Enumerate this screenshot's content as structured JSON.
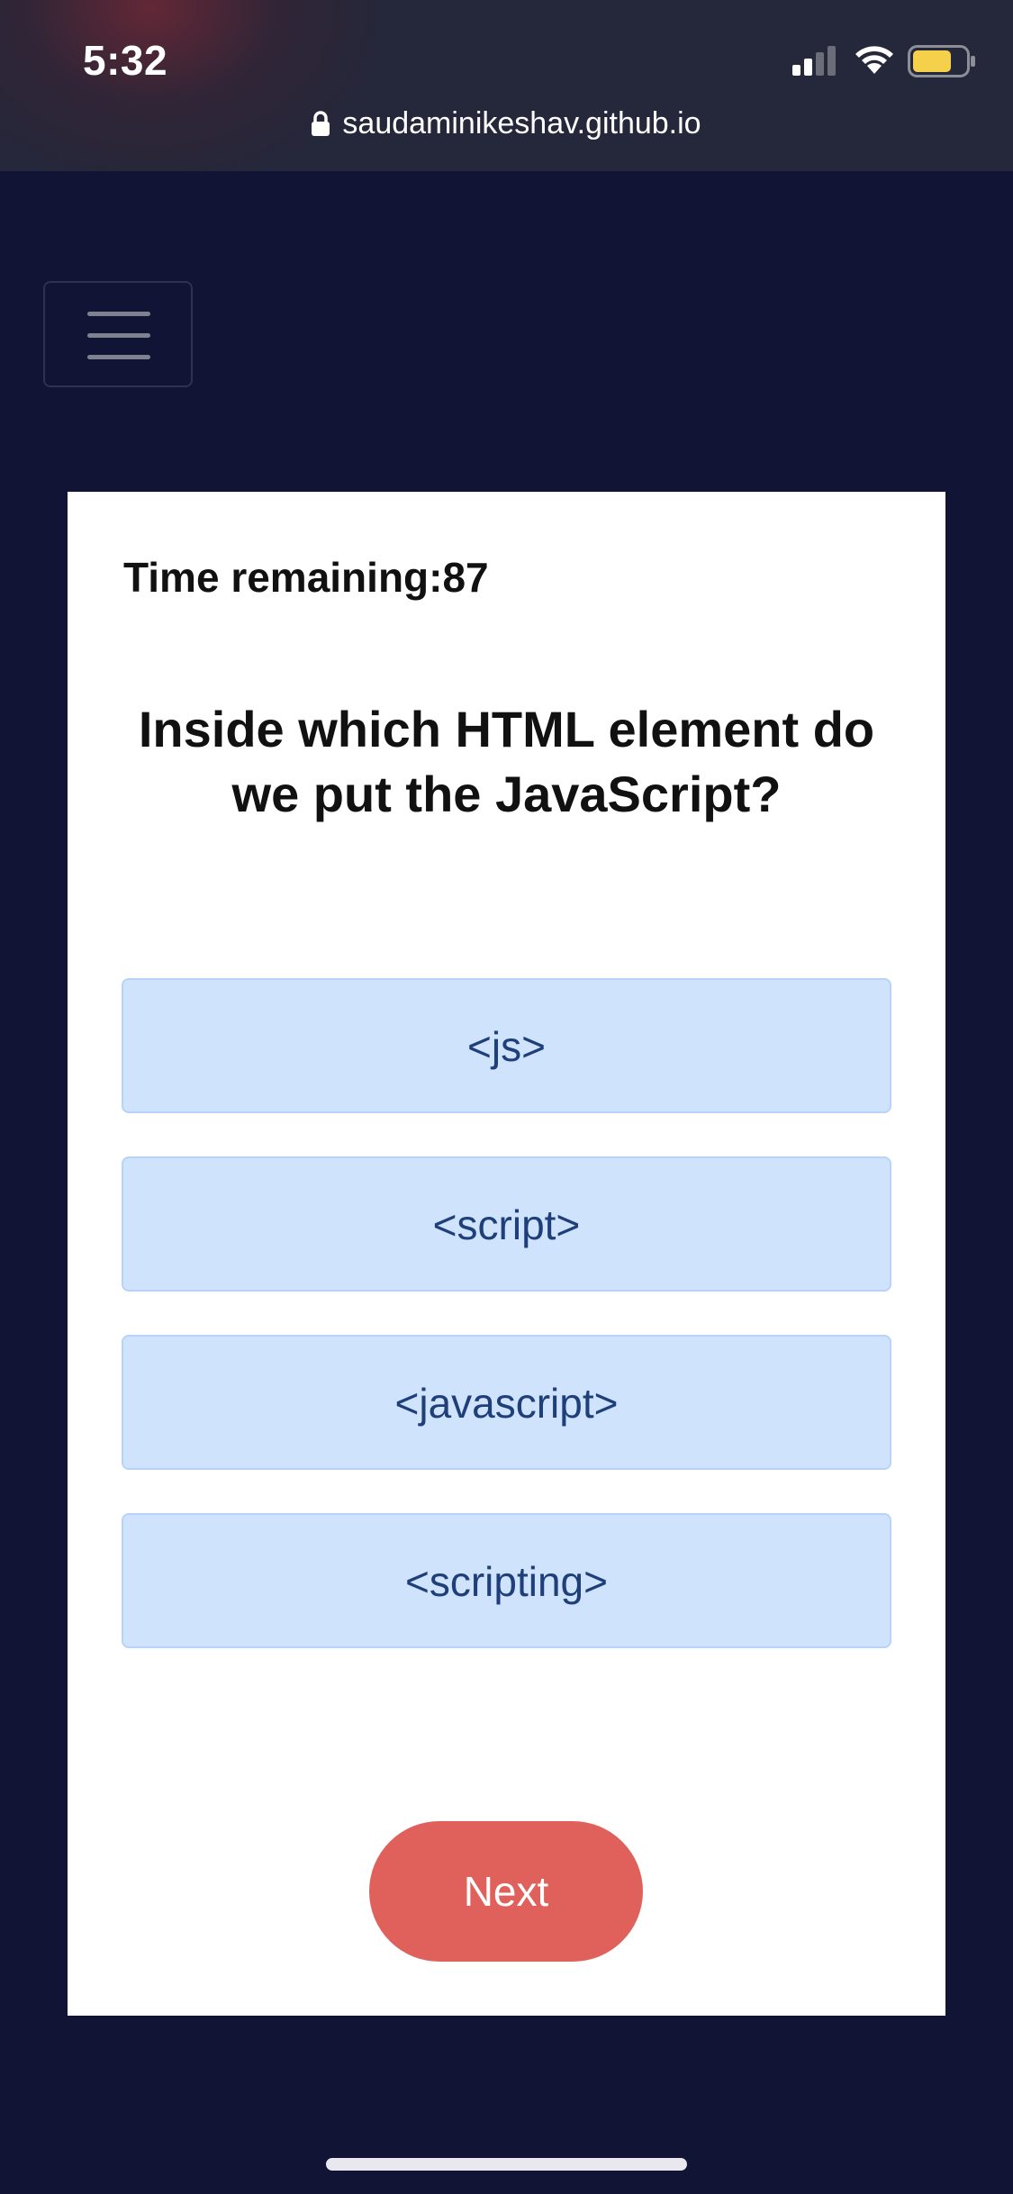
{
  "status_bar": {
    "time": "5:32",
    "icons": [
      "signal-icon",
      "wifi-icon",
      "battery-icon"
    ],
    "battery_color": "#f5d04a"
  },
  "browser": {
    "url": "saudaminikeshav.github.io",
    "lock_icon": "lock-icon"
  },
  "nav": {
    "menu_icon": "hamburger-menu-icon"
  },
  "quiz": {
    "timer_text": "Time remaining:87",
    "question": "Inside which HTML element do we put the JavaScript?",
    "choices": [
      {
        "label": "<js>"
      },
      {
        "label": "<script>"
      },
      {
        "label": "<javascript>"
      },
      {
        "label": "<scripting>"
      }
    ],
    "next_label": "Next"
  },
  "colors": {
    "page_background": "#121435",
    "card_background": "#ffffff",
    "choice_background": "#d0e3fc",
    "choice_text": "#1e3f7a",
    "next_button": "#e0615b"
  }
}
